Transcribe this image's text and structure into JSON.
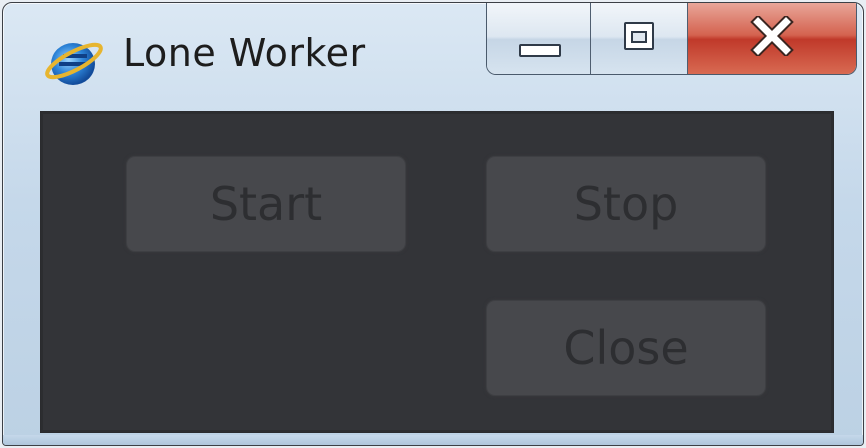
{
  "window": {
    "title": "Lone Worker",
    "app_icon": "internet-explorer-icon",
    "caption_buttons": {
      "minimize_icon": "minimize-icon",
      "maximize_icon": "maximize-icon",
      "close_icon": "close-icon",
      "close_color": "#c9412f"
    }
  },
  "main": {
    "background_color": "#333438",
    "buttons": {
      "start_label": "Start",
      "stop_label": "Stop",
      "close_label": "Close"
    }
  }
}
